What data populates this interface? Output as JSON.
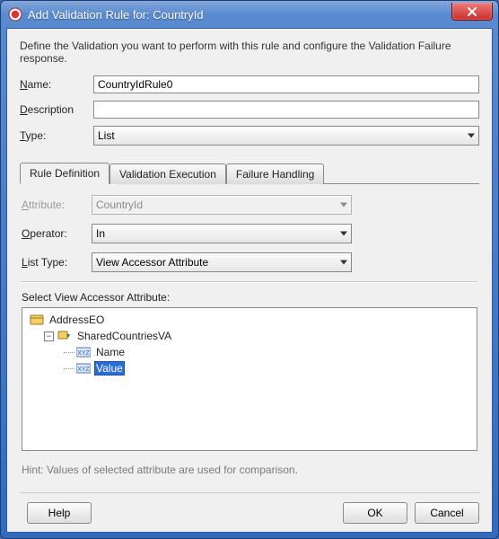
{
  "window": {
    "title": "Add Validation Rule for: CountryId",
    "close_tooltip": "Close"
  },
  "intro": "Define the Validation you want to perform with this rule and configure the Validation Failure response.",
  "form": {
    "name_label": "Name:",
    "name_value": "CountryIdRule0",
    "desc_label": "Description",
    "desc_value": "",
    "type_label": "Type:",
    "type_value": "List"
  },
  "tabs": [
    {
      "label": "Rule Definition"
    },
    {
      "label": "Validation Execution"
    },
    {
      "label": "Failure Handling"
    }
  ],
  "panel": {
    "attribute_label": "Attribute:",
    "attribute_value": "CountryId",
    "operator_label": "Operator:",
    "operator_value": "In",
    "listtype_label": "List Type:",
    "listtype_value": "View Accessor Attribute",
    "tree_label": "Select View Accessor Attribute:",
    "tree": {
      "root": "AddressEO",
      "child": "SharedCountriesVA",
      "leaf1": "Name",
      "leaf2": "Value",
      "selected": "Value"
    },
    "hint": "Hint: Values of selected attribute are used for comparison."
  },
  "buttons": {
    "help": "Help",
    "ok": "OK",
    "cancel": "Cancel"
  }
}
